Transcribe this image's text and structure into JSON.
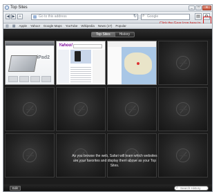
{
  "window": {
    "title": "Top Sites",
    "controls": [
      "_",
      "□",
      "✕"
    ]
  },
  "toolbar": {
    "back": "◀",
    "forward": "▶",
    "address_placeholder": "Go to this address",
    "reload": "↻",
    "search_placeholder": "Google",
    "page_icon": "▤",
    "gear": "⚙"
  },
  "annotation": "Click the Gear Icon here to",
  "bookmarks": {
    "items": [
      "Apple",
      "Yahoo!",
      "Google Maps",
      "YouTube",
      "Wikipedia",
      "News (17)",
      "Popular"
    ]
  },
  "topbar": {
    "tabs": [
      "Top Sites",
      "History"
    ]
  },
  "thumbnails": {
    "t1_brand": "iPad2",
    "t2_logo": "Yahoo!"
  },
  "caption": "As you browse the web, Safari will learn which websites are your favorites and display them above as your Top Sites.",
  "statusbar": {
    "edit_label": "Edit",
    "search_placeholder": "Search History"
  }
}
